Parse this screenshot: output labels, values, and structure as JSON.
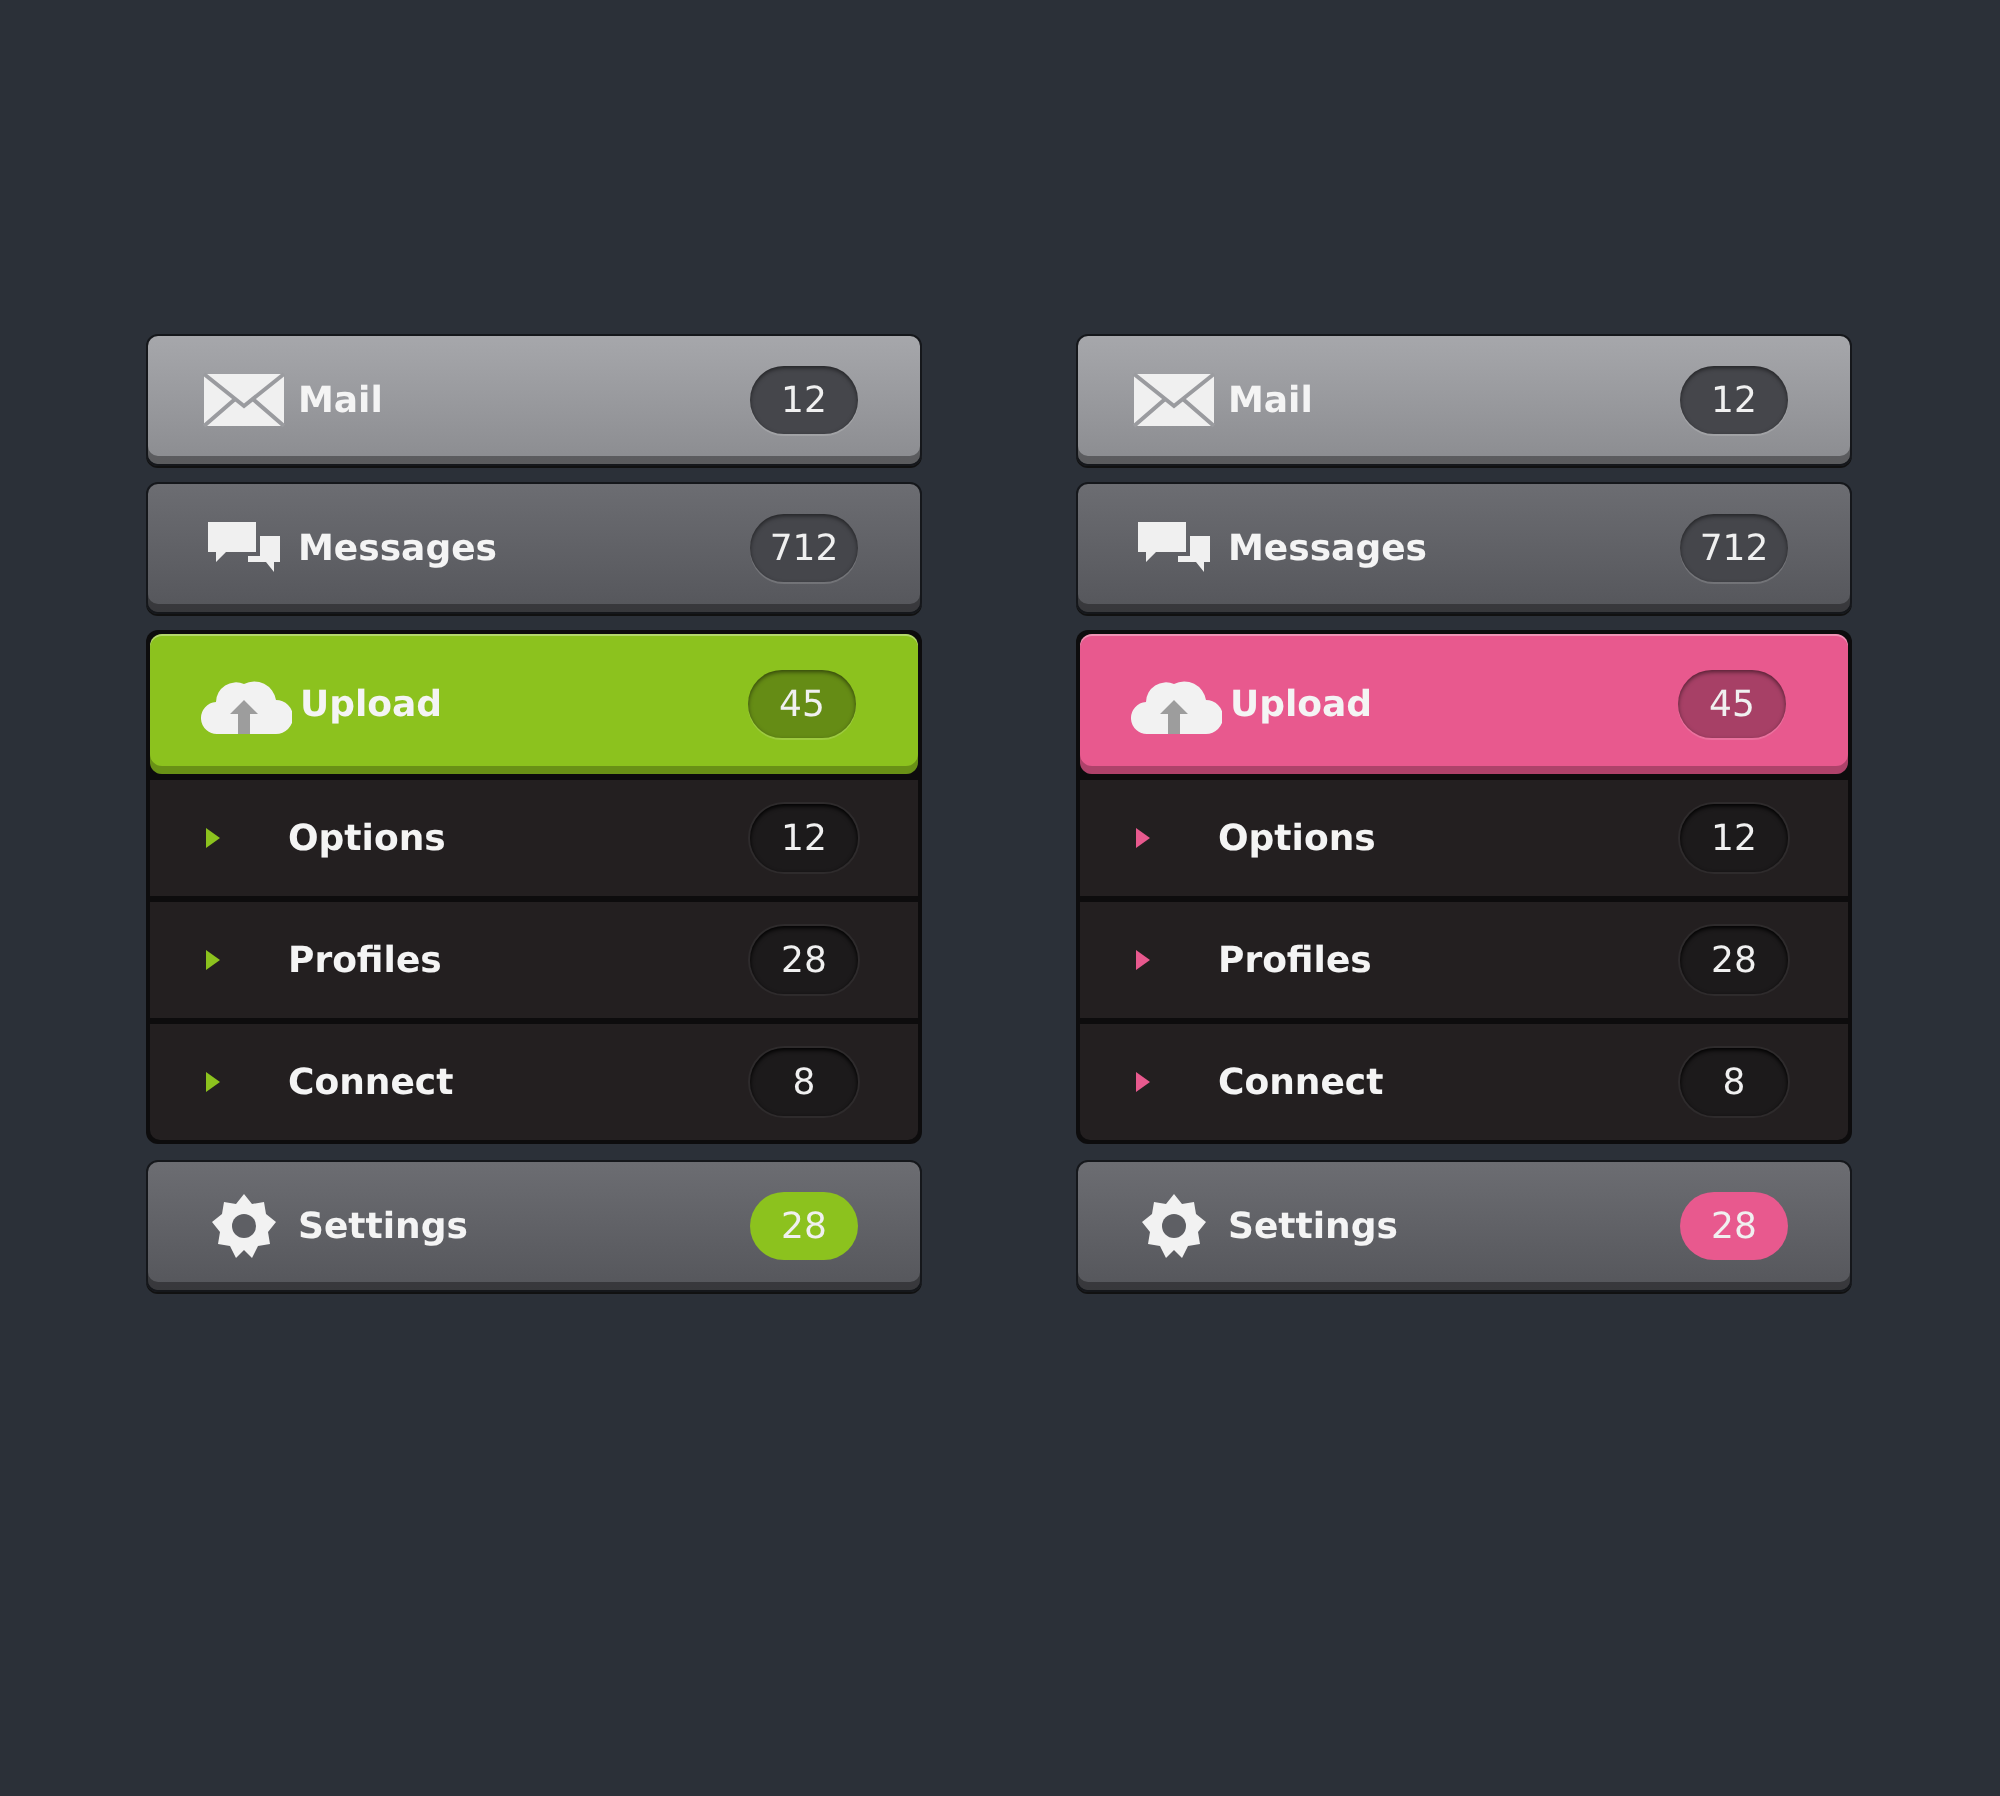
{
  "menus": [
    {
      "color": "#8cc21e",
      "items": [
        {
          "kind": "mail",
          "label": "Mail",
          "count": "12",
          "highlighted": true,
          "selected": false,
          "expanded": false,
          "badge_accent": false
        },
        {
          "kind": "messages",
          "label": "Messages",
          "count": "712",
          "highlighted": false,
          "selected": false,
          "expanded": false,
          "badge_accent": false
        },
        {
          "kind": "upload",
          "label": "Upload",
          "count": "45",
          "highlighted": false,
          "selected": true,
          "expanded": true,
          "badge_accent": false,
          "children": [
            {
              "label": "Options",
              "count": "12"
            },
            {
              "label": "Profiles",
              "count": "28"
            },
            {
              "label": "Connect",
              "count": "8"
            }
          ]
        },
        {
          "kind": "settings",
          "label": "Settings",
          "count": "28",
          "highlighted": false,
          "selected": false,
          "expanded": false,
          "badge_accent": true
        }
      ]
    },
    {
      "color": "#e8598e",
      "items": [
        {
          "kind": "mail",
          "label": "Mail",
          "count": "12",
          "highlighted": true,
          "selected": false,
          "expanded": false,
          "badge_accent": false
        },
        {
          "kind": "messages",
          "label": "Messages",
          "count": "712",
          "highlighted": false,
          "selected": false,
          "expanded": false,
          "badge_accent": false
        },
        {
          "kind": "upload",
          "label": "Upload",
          "count": "45",
          "highlighted": false,
          "selected": true,
          "expanded": true,
          "badge_accent": false,
          "children": [
            {
              "label": "Options",
              "count": "12"
            },
            {
              "label": "Profiles",
              "count": "28"
            },
            {
              "label": "Connect",
              "count": "8"
            }
          ]
        },
        {
          "kind": "settings",
          "label": "Settings",
          "count": "28",
          "highlighted": false,
          "selected": false,
          "expanded": false,
          "badge_accent": true
        }
      ]
    }
  ]
}
